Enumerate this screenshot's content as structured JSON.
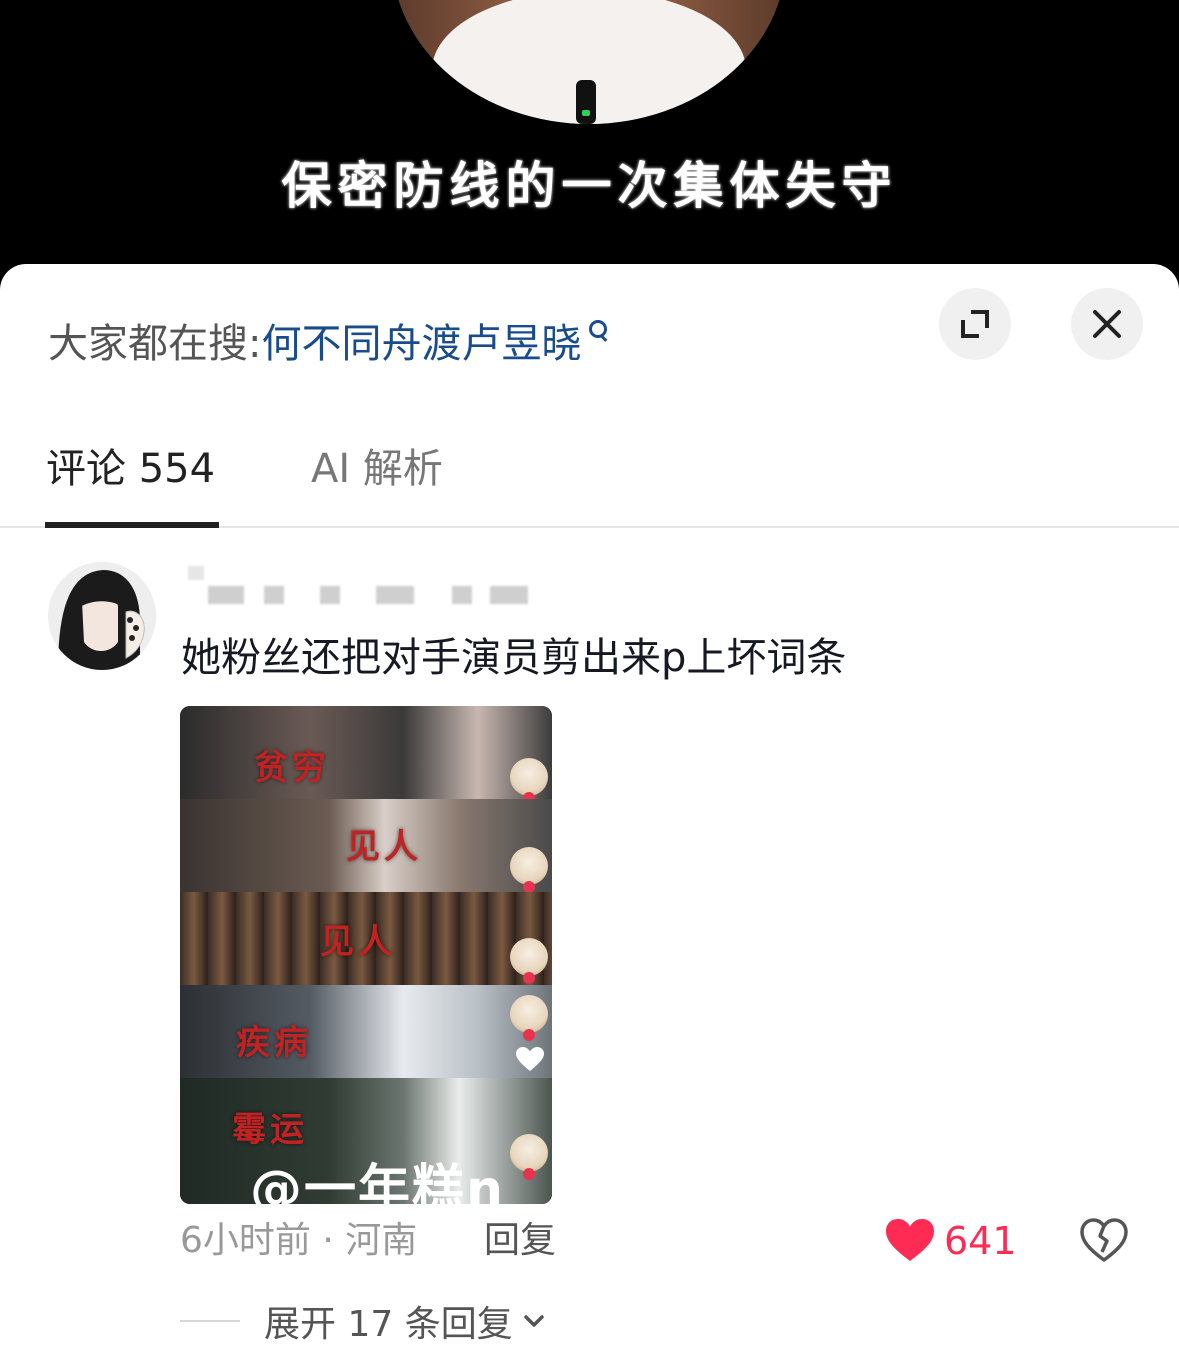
{
  "video": {
    "caption": "保密防线的一次集体失守"
  },
  "sheet": {
    "search": {
      "prefix": "大家都在搜:",
      "term": "何不同舟渡卢昱晓"
    },
    "tabs": [
      {
        "label": "评论 554",
        "active": true
      },
      {
        "label": "AI 解析",
        "active": false
      }
    ]
  },
  "comment": {
    "text": "她粉丝还把对手演员剪出来p上坏词条",
    "image": {
      "words": [
        "贫穷",
        "见人",
        "见人",
        "疾病",
        "霉运"
      ],
      "watermark": "@一年糕n"
    },
    "meta": "6小时前 · 河南",
    "reply_label": "回复",
    "like_count": "641",
    "expand_replies_label": "展开 17 条回复"
  },
  "colors": {
    "like": "#fe2c55",
    "search_term": "#1a4c8c",
    "text_primary": "#161823"
  }
}
